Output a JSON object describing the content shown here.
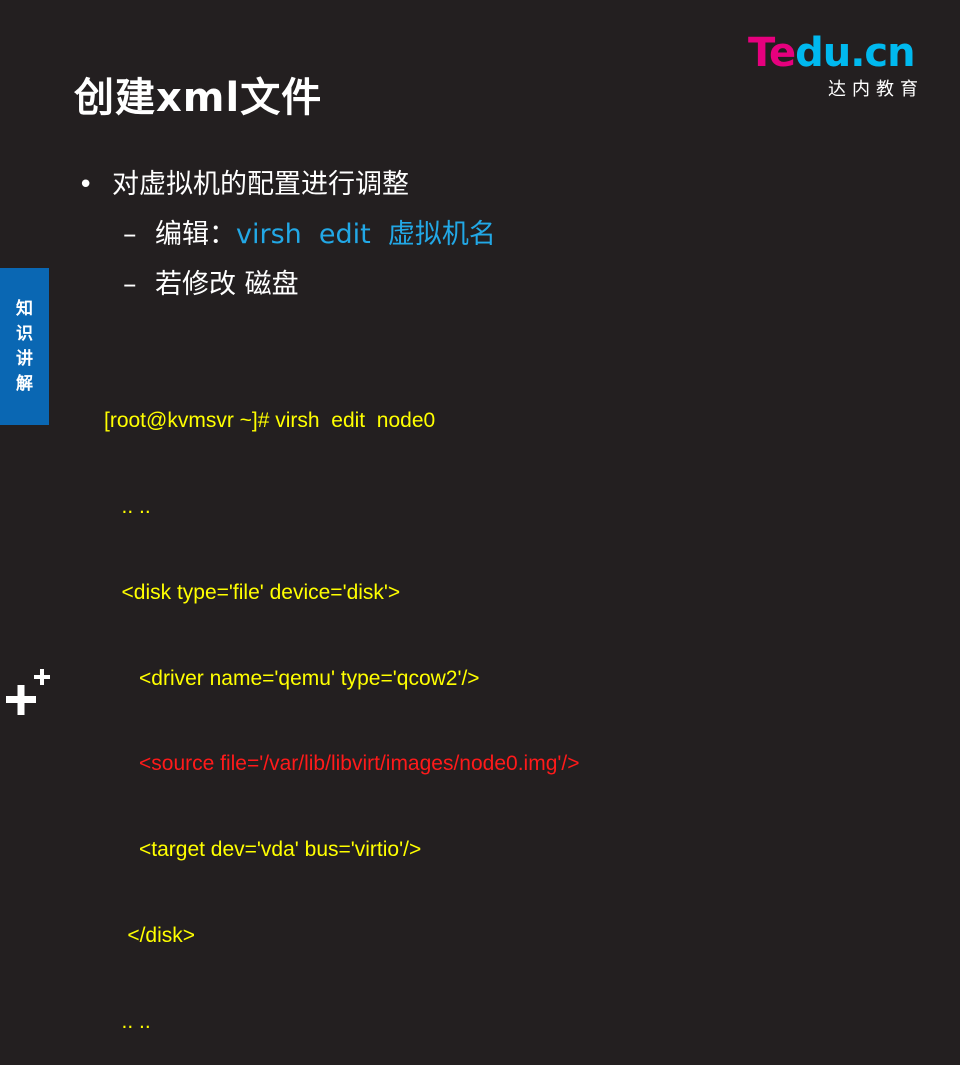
{
  "slide": {
    "title": "创建xml文件",
    "side_tab": "知识讲解"
  },
  "logo": {
    "brand_part1": "Te",
    "brand_part2": "du.cn",
    "subtitle": "达内教育"
  },
  "bullets": {
    "main": "对虚拟机的配置进行调整",
    "sub1_prefix": "编辑：",
    "sub1_command": "virsh  edit  虚拟机名",
    "sub2": "若修改 磁盘"
  },
  "code": {
    "lines": [
      "[root@kvmsvr ~]# virsh  edit  node0",
      "   .. ..",
      "   <disk type='file' device='disk'>",
      "      <driver name='qemu' type='qcow2'/>",
      "      <source file='/var/lib/libvirt/images/node0.img'/>",
      "      <target dev='vda' bus='virtio'/>",
      "    </disk>",
      "   .. .."
    ]
  },
  "colors": {
    "background": "#231f20",
    "accent_blue": "#0a67b3",
    "cyan_text": "#22a8e6",
    "code_yellow": "#ffff00",
    "code_red": "#ff1a1a",
    "logo_pink": "#e6007e",
    "logo_cyan": "#00b9ef"
  },
  "icons": {
    "plus_logo": "plus-icon"
  }
}
